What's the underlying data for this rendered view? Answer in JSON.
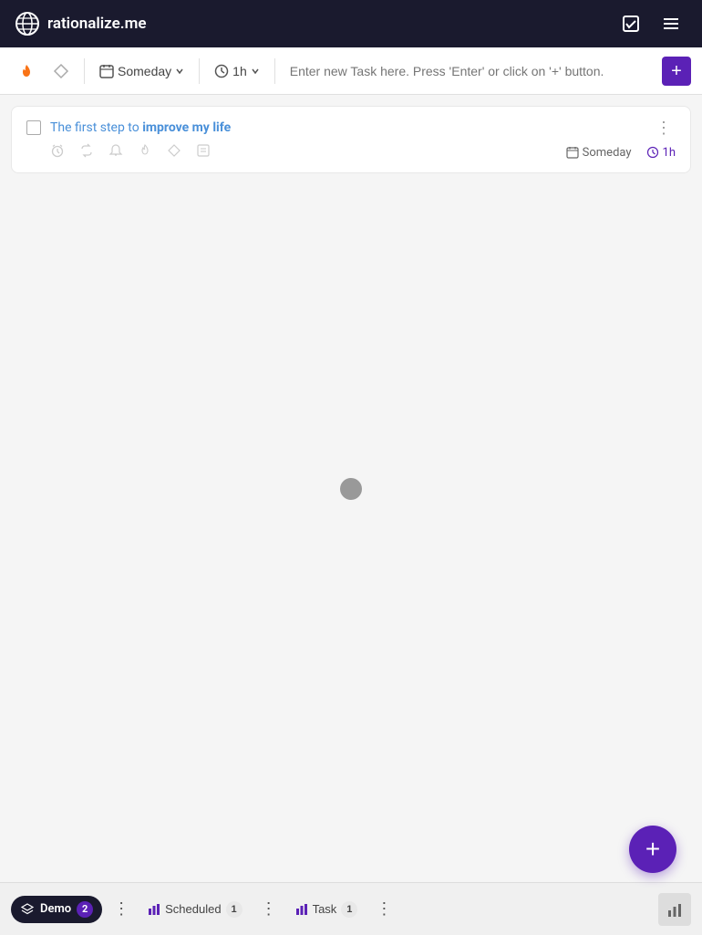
{
  "app": {
    "title": "rationalize.me",
    "logo_label": "globe-icon"
  },
  "navbar": {
    "actions": {
      "checkbox_icon": "checkbox-icon",
      "menu_icon": "menu-icon"
    }
  },
  "toolbar": {
    "fire_icon": "fire-icon",
    "diamond_icon": "diamond-icon",
    "schedule_label": "Someday",
    "schedule_icon": "calendar-icon",
    "time_label": "1h",
    "time_icon": "clock-icon",
    "input_placeholder": "Enter new Task here. Press 'Enter' or click on '+' button.",
    "add_button_label": "+"
  },
  "tasks": [
    {
      "id": 1,
      "title_prefix": "The first step to ",
      "title_highlight": "improve my life",
      "schedule": "Someday",
      "time": "1h",
      "checked": false
    }
  ],
  "bottom_bar": {
    "workspace_name": "Demo",
    "workspace_count": "2",
    "scheduled_label": "Scheduled",
    "scheduled_count": "1",
    "task_label": "Task",
    "task_count": "1",
    "stats_icon": "bar-chart-icon"
  },
  "fab": {
    "label": "+"
  },
  "colors": {
    "primary": "#5b21b6",
    "navbar_bg": "#1a1a2e",
    "task_title": "#4a90d9"
  }
}
